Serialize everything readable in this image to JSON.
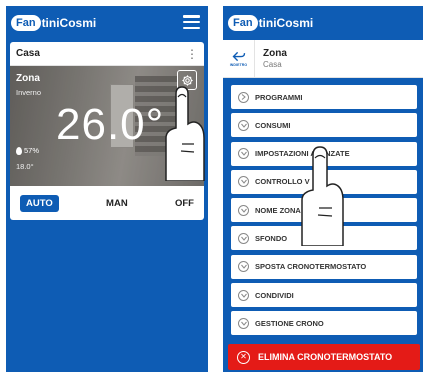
{
  "brand": {
    "pill": "Fan",
    "rest": "tiniCosmi"
  },
  "left": {
    "card_title": "Casa",
    "zone_name": "Zona",
    "season": "Inverno",
    "temperature": "26.0°",
    "humidity": "57%",
    "setpoint": "18.0°",
    "modes": [
      "AUTO",
      "MAN",
      "OFF"
    ],
    "active_mode": "AUTO"
  },
  "right": {
    "back_label": "INDIETRO",
    "title": "Zona",
    "subtitle": "Casa",
    "menu_items": [
      "PROGRAMMI",
      "CONSUMI",
      "IMPOSTAZIONI AVANZATE",
      "CONTROLLO V",
      "NOME ZONA",
      "SFONDO",
      "SPOSTA CRONOTERMOSTATO",
      "CONDIVIDI",
      "GESTIONE CRONO"
    ],
    "delete_label": "ELIMINA CRONOTERMOSTATO"
  },
  "colors": {
    "brand_blue": "#0e5cb4",
    "danger_red": "#e41b17",
    "card_bg": "#ffffff"
  },
  "icons": [
    "hamburger-icon",
    "kebab-menu-icon",
    "gear-icon",
    "water-drop-icon",
    "back-arrow-icon",
    "chevron-circle-icon",
    "close-circle-icon",
    "pointing-hand-icon"
  ]
}
